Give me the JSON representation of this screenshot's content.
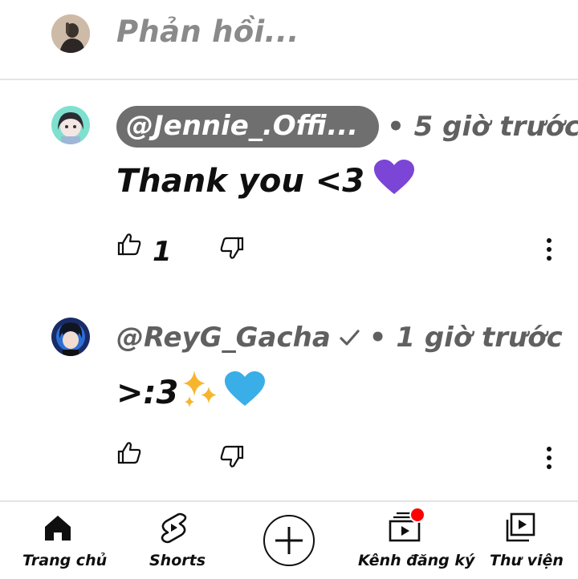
{
  "reply": {
    "placeholder": "Phản hồi..."
  },
  "comments": [
    {
      "author": "@Jennie_.Offi...",
      "time": "• 5 giờ trước",
      "text": "Thank you <3",
      "emoji": "💜",
      "likes": "1",
      "author_highlighted": true
    },
    {
      "author": "@ReyG_Gacha",
      "time": "• 1 giờ trước",
      "text": ">:3",
      "emoji": "✨💙",
      "likes": "",
      "verified": true
    }
  ],
  "bottom_nav": {
    "items": [
      {
        "label": "Trang chủ",
        "icon": "home-icon"
      },
      {
        "label": "Shorts",
        "icon": "shorts-icon"
      },
      {
        "label": "",
        "icon": "create-icon"
      },
      {
        "label": "Kênh đăng ký",
        "icon": "subscriptions-icon",
        "notification_dot": true
      },
      {
        "label": "Thư viện",
        "icon": "library-icon"
      }
    ]
  },
  "colors": {
    "notification": "#ff0000",
    "pill_background": "#6f6f6f",
    "muted_text": "#606060"
  }
}
